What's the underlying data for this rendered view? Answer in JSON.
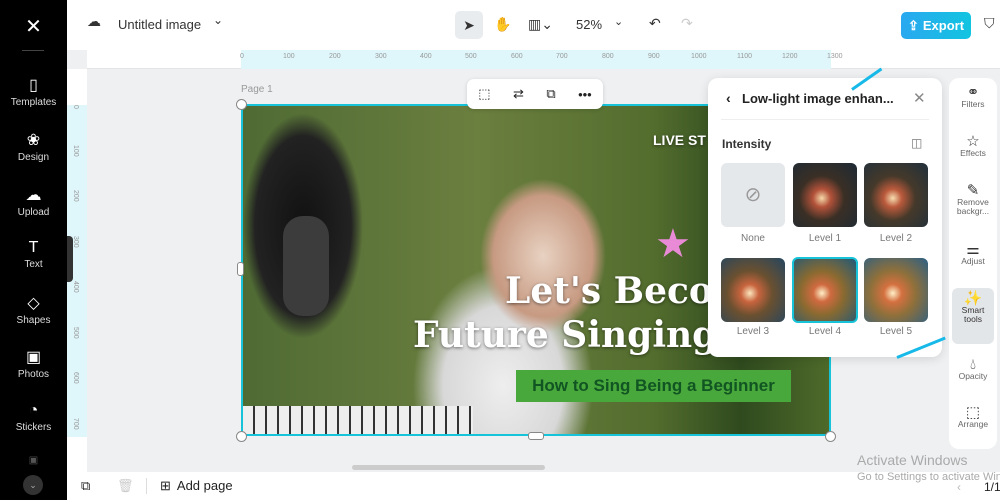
{
  "sidebar": {
    "items": [
      {
        "label": "Templates",
        "icon": "templates-icon"
      },
      {
        "label": "Design",
        "icon": "design-icon"
      },
      {
        "label": "Upload",
        "icon": "upload-icon"
      },
      {
        "label": "Text",
        "icon": "text-icon"
      },
      {
        "label": "Shapes",
        "icon": "shapes-icon"
      },
      {
        "label": "Photos",
        "icon": "photos-icon"
      },
      {
        "label": "Stickers",
        "icon": "stickers-icon"
      }
    ]
  },
  "header": {
    "title": "Untitled image",
    "zoom": "52%",
    "export_label": "Export"
  },
  "ruler": {
    "h": [
      "0",
      "100",
      "200",
      "300",
      "400",
      "500",
      "600",
      "700",
      "800",
      "900",
      "1000",
      "1100",
      "1200",
      "1300"
    ],
    "v": [
      "0",
      "100",
      "200",
      "300",
      "400",
      "500",
      "600",
      "700"
    ]
  },
  "canvas": {
    "page_label": "Page 1",
    "live": "LIVE ST",
    "headline1": "Let's Becom",
    "headline2": "Future Singing",
    "tagline": "How to Sing Being a Beginner"
  },
  "panel": {
    "title": "Low-light image enhan...",
    "section": "Intensity",
    "options": [
      {
        "label": "None"
      },
      {
        "label": "Level 1"
      },
      {
        "label": "Level 2"
      },
      {
        "label": "Level 3"
      },
      {
        "label": "Level 4",
        "selected": true
      },
      {
        "label": "Level 5"
      }
    ]
  },
  "tools": [
    {
      "label": "Filters"
    },
    {
      "label": "Effects"
    },
    {
      "label": "Remove backgr..."
    },
    {
      "label": "Adjust"
    },
    {
      "label": "Smart tools",
      "active": true
    },
    {
      "label": "Opacity"
    },
    {
      "label": "Arrange"
    }
  ],
  "bottom": {
    "add_page": "Add page",
    "page_count": "1/1"
  },
  "watermark": {
    "line1": "Activate Windows",
    "line2": "Go to Settings to activate Windows."
  },
  "colors": {
    "accent": "#17c3d8",
    "export": "#1fb5ea",
    "tagline_bg": "#49a83c"
  }
}
